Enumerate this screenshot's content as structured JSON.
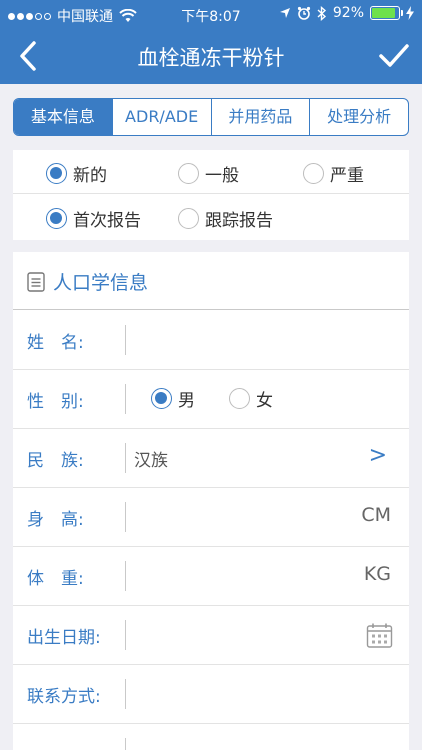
{
  "status_bar": {
    "carrier": "中国联通",
    "time": "下午8:07",
    "battery_text": "92%",
    "battery_level": 0.92
  },
  "nav": {
    "title": "血栓通冻干粉针"
  },
  "tabs": [
    {
      "label": "基本信息",
      "active": true
    },
    {
      "label": "ADR/ADE",
      "active": false
    },
    {
      "label": "并用药品",
      "active": false
    },
    {
      "label": "处理分析",
      "active": false
    }
  ],
  "severity": {
    "options": [
      {
        "label": "新的",
        "checked": true
      },
      {
        "label": "一般",
        "checked": false
      },
      {
        "label": "严重",
        "checked": false
      }
    ]
  },
  "report_type": {
    "options": [
      {
        "label": "首次报告",
        "checked": true
      },
      {
        "label": "跟踪报告",
        "checked": false
      }
    ]
  },
  "demographics": {
    "title": "人口学信息",
    "fields": {
      "name": {
        "label": "姓　名:",
        "value": ""
      },
      "gender": {
        "label": "性　别:",
        "male": "男",
        "female": "女",
        "selected": "男"
      },
      "ethnicity": {
        "label": "民　族:",
        "value": "汉族",
        "chevron": ">"
      },
      "height": {
        "label": "身　高:",
        "value": "",
        "unit": "CM"
      },
      "weight": {
        "label": "体　重:",
        "value": "",
        "unit": "KG"
      },
      "birthdate": {
        "label": "出生日期:",
        "value": ""
      },
      "contact": {
        "label": "联系方式:",
        "value": ""
      }
    }
  },
  "colors": {
    "accent": "#3a7cc4",
    "background": "#efeff4",
    "battery": "#6ee14c"
  }
}
